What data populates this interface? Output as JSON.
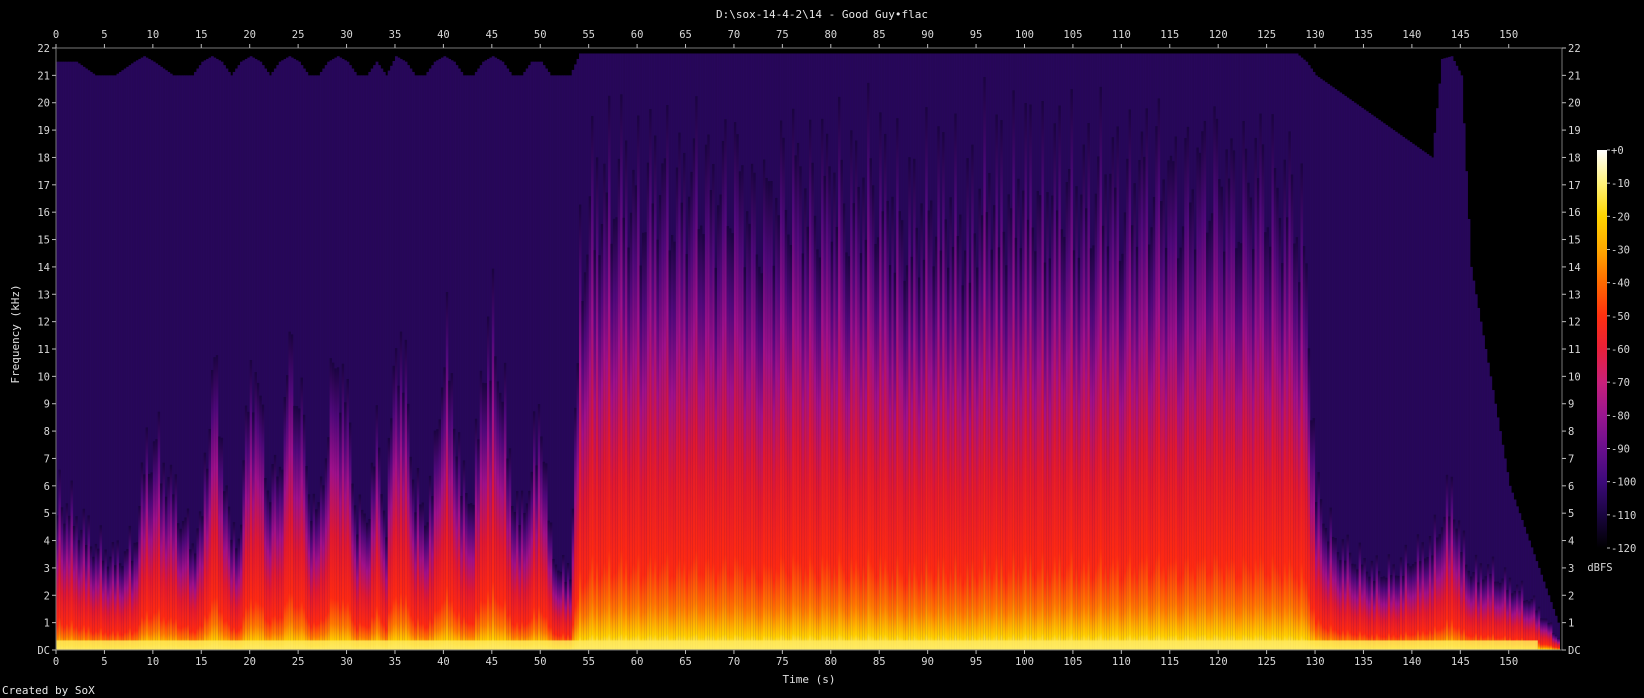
{
  "chart_data": {
    "type": "heatmap",
    "title": "D:\\sox-14-4-2\\14 - Good Guy•flac",
    "xlabel": "Time (s)",
    "ylabel": "Frequency (kHz)",
    "xlim": [
      0,
      155.5
    ],
    "ylim": [
      0,
      22
    ],
    "x_ticks": [
      "0",
      "5",
      "10",
      "15",
      "20",
      "25",
      "30",
      "35",
      "40",
      "45",
      "50",
      "55",
      "60",
      "65",
      "70",
      "75",
      "80",
      "85",
      "90",
      "95",
      "100",
      "105",
      "110",
      "115",
      "120",
      "125",
      "130",
      "135",
      "140",
      "145",
      "150"
    ],
    "y_ticks": [
      "DC",
      "1",
      "2",
      "3",
      "4",
      "5",
      "6",
      "7",
      "8",
      "9",
      "10",
      "11",
      "12",
      "13",
      "14",
      "15",
      "16",
      "17",
      "18",
      "19",
      "20",
      "21",
      "22"
    ],
    "colorbar": {
      "label": "dBFS",
      "range": [
        -120,
        0
      ],
      "ticks": [
        "+0",
        "-10",
        "-20",
        "-30",
        "-40",
        "-50",
        "-60",
        "-70",
        "-80",
        "-90",
        "-100",
        "-110",
        "-120"
      ],
      "colors": [
        "#000000",
        "#1a0540",
        "#3d0a7a",
        "#6a0f8c",
        "#9a1690",
        "#c8207a",
        "#e8203a",
        "#ff3010",
        "#ff6a00",
        "#ffa800",
        "#ffd400",
        "#fff27a",
        "#ffffff"
      ]
    },
    "energy_profile": {
      "description_free": true,
      "seconds": [
        0,
        2,
        4,
        6,
        8,
        9,
        10,
        12,
        14,
        15,
        16,
        17,
        18,
        19,
        20,
        21,
        22,
        23,
        24,
        25,
        26,
        27,
        28,
        29,
        30,
        31,
        32,
        33,
        34,
        35,
        36,
        37,
        38,
        39,
        40,
        41,
        42,
        43,
        44,
        45,
        46,
        47,
        48,
        49,
        50,
        51,
        52,
        53,
        54,
        55,
        56,
        58,
        60,
        62,
        64,
        66,
        68,
        70,
        72,
        74,
        76,
        78,
        80,
        82,
        84,
        86,
        88,
        90,
        92,
        94,
        96,
        98,
        100,
        102,
        104,
        106,
        108,
        110,
        112,
        114,
        116,
        118,
        120,
        122,
        124,
        126,
        128,
        129,
        130,
        132,
        134,
        136,
        138,
        140,
        142,
        143,
        144,
        145,
        146,
        148,
        150,
        152,
        153,
        154,
        155
      ],
      "top_khz": [
        6,
        5,
        4,
        3.5,
        4,
        7,
        8,
        6,
        4,
        5,
        11,
        8,
        4,
        5,
        11,
        9,
        6,
        7,
        11,
        10,
        6,
        5,
        9,
        11,
        9,
        5,
        5,
        8,
        5,
        12,
        10,
        6,
        5,
        7,
        12,
        9,
        6,
        6,
        11,
        12,
        10,
        6,
        5,
        7,
        9,
        4,
        3,
        3,
        14,
        17,
        17,
        18,
        17,
        18,
        17,
        18,
        17,
        18,
        16,
        17,
        18,
        17,
        18,
        17,
        18,
        17,
        16,
        17,
        17,
        16,
        18,
        17,
        18,
        17,
        18,
        17,
        18,
        17,
        18,
        18,
        17,
        18,
        18,
        17,
        18,
        17,
        17,
        14,
        6,
        4,
        3.5,
        3,
        3,
        3.5,
        4,
        5,
        6,
        4,
        3,
        3,
        2.5,
        2,
        1.5,
        1,
        0.5
      ],
      "hf_khz": [
        21.5,
        21.5,
        21,
        21,
        21.5,
        21.7,
        21.5,
        21,
        21,
        21.5,
        21.7,
        21.5,
        21,
        21.5,
        21.7,
        21.5,
        21,
        21.5,
        21.7,
        21.5,
        21,
        21,
        21.5,
        21.7,
        21.5,
        21,
        21,
        21.5,
        21,
        21.7,
        21.5,
        21,
        21,
        21.5,
        21.7,
        21.5,
        21,
        21,
        21.5,
        21.7,
        21.5,
        21,
        21,
        21.5,
        21.5,
        21,
        21,
        21,
        21.8,
        21.8,
        21.8,
        21.8,
        21.8,
        21.8,
        21.8,
        21.8,
        21.8,
        21.8,
        21.8,
        21.8,
        21.8,
        21.8,
        21.8,
        21.8,
        21.8,
        21.8,
        21.8,
        21.8,
        21.8,
        21.8,
        21.8,
        21.8,
        21.8,
        21.8,
        21.8,
        21.8,
        21.8,
        21.8,
        21.8,
        21.8,
        21.8,
        21.8,
        21.8,
        21.8,
        21.8,
        21.8,
        21.8,
        21.5,
        21,
        20.5,
        20,
        19.5,
        19,
        18.5,
        18,
        21.6,
        21.7,
        21,
        14,
        10,
        6,
        4,
        3,
        2,
        1
      ]
    }
  },
  "footer": {
    "credit": "Created by SoX"
  }
}
